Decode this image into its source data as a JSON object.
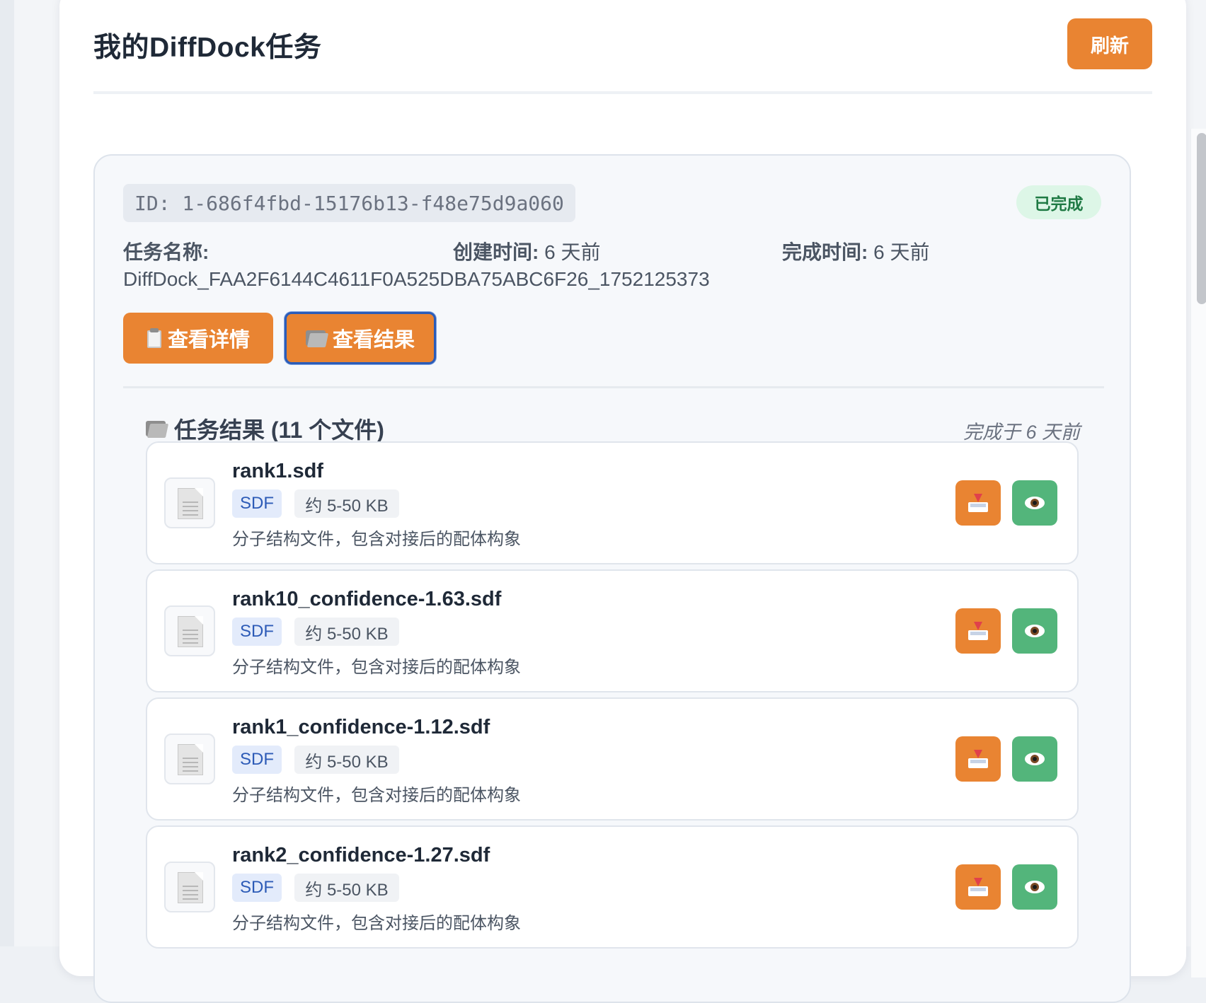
{
  "header": {
    "title": "我的DiffDock任务",
    "refresh_label": "刷新"
  },
  "task": {
    "id_text": "ID: 1-686f4fbd-15176b13-f48e75d9a060",
    "status": "已完成",
    "name_label": "任务名称:",
    "name_value": "DiffDock_FAA2F6144C4611F0A525DBA75ABC6F26_1752125373",
    "created_label": "创建时间:",
    "created_value": "6 天前",
    "completed_label": "完成时间:",
    "completed_value": "6 天前",
    "detail_button": "查看详情",
    "results_button": "查看结果"
  },
  "results": {
    "title": "任务结果 (11 个文件)",
    "completed_time": "完成于 6 天前",
    "files": [
      {
        "name": "rank1.sdf",
        "type": "SDF",
        "size": "约 5-50 KB",
        "description": "分子结构文件，包含对接后的配体构象"
      },
      {
        "name": "rank10_confidence-1.63.sdf",
        "type": "SDF",
        "size": "约 5-50 KB",
        "description": "分子结构文件，包含对接后的配体构象"
      },
      {
        "name": "rank1_confidence-1.12.sdf",
        "type": "SDF",
        "size": "约 5-50 KB",
        "description": "分子结构文件，包含对接后的配体构象"
      },
      {
        "name": "rank2_confidence-1.27.sdf",
        "type": "SDF",
        "size": "约 5-50 KB",
        "description": "分子结构文件，包含对接后的配体构象"
      }
    ]
  },
  "icons": {
    "detail": "clipboard-icon",
    "results": "folder-icon",
    "file": "document-icon",
    "download": "inbox-tray-icon",
    "preview": "eye-icon"
  },
  "colors": {
    "accent": "#e98432",
    "success": "#53b57b",
    "status_bg": "#ddf6e7",
    "status_text": "#1f7a44",
    "focus_ring": "#2b5cb8"
  }
}
